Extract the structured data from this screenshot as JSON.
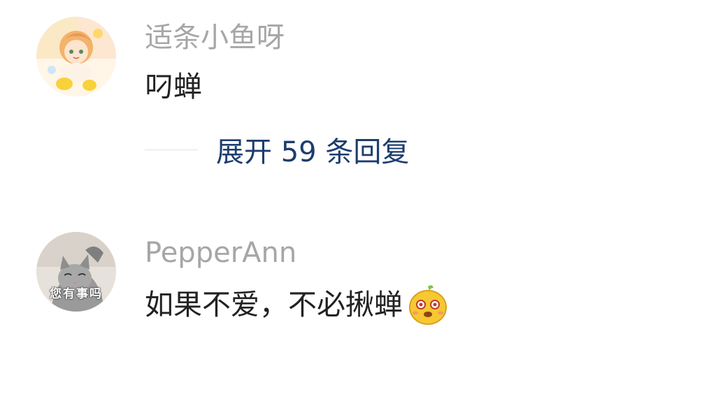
{
  "comments": [
    {
      "username": "适条小鱼呀",
      "text": "叼蝉",
      "avatar": "anime-girl-avatar",
      "replies_label": "展开 59 条回复"
    },
    {
      "username": "PepperAnn",
      "text": "如果不爱，不必揪蝉",
      "avatar": "gray-cat-avatar",
      "avatar_caption": "您有事吗",
      "emoji": "yellow-face-emoji"
    }
  ],
  "colors": {
    "username": "#a6a6a6",
    "text": "#222222",
    "link": "#1d3d6e",
    "divider": "#e3e3e3"
  }
}
